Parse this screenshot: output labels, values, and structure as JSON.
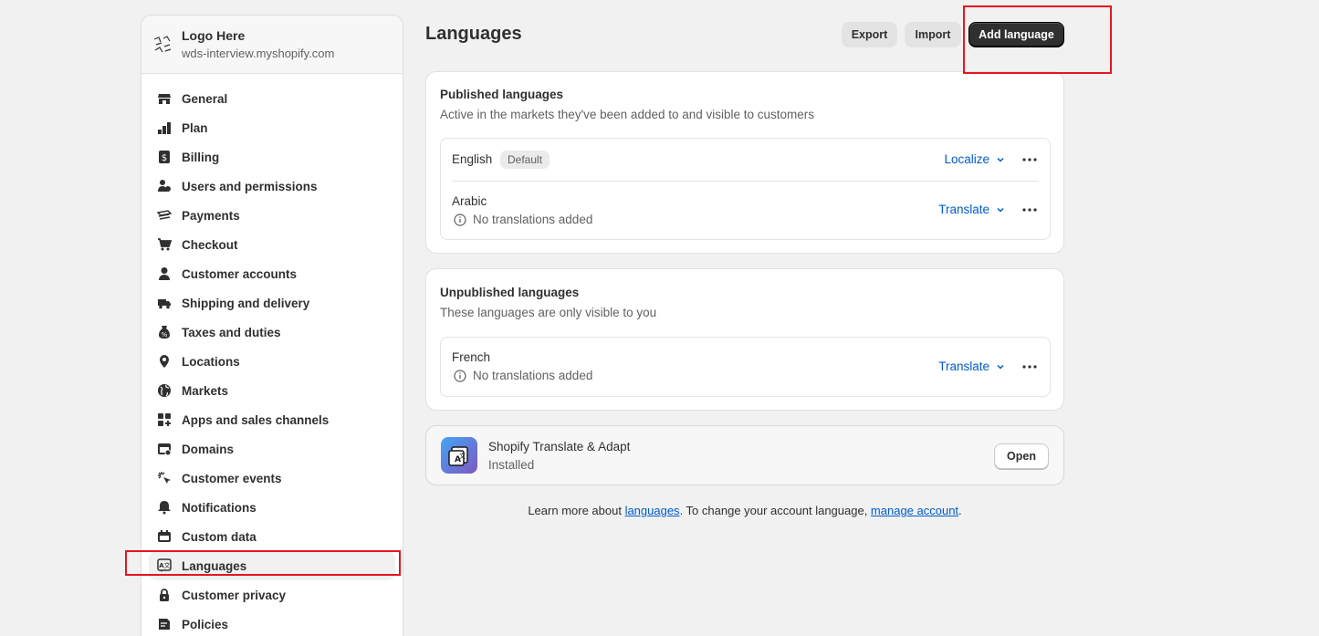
{
  "store": {
    "name": "Logo Here",
    "url": "wds-interview.myshopify.com"
  },
  "sidebar": {
    "items": [
      {
        "label": "General",
        "icon": "store-icon"
      },
      {
        "label": "Plan",
        "icon": "plan-icon"
      },
      {
        "label": "Billing",
        "icon": "billing-icon"
      },
      {
        "label": "Users and permissions",
        "icon": "users-icon"
      },
      {
        "label": "Payments",
        "icon": "payments-icon"
      },
      {
        "label": "Checkout",
        "icon": "cart-icon"
      },
      {
        "label": "Customer accounts",
        "icon": "person-icon"
      },
      {
        "label": "Shipping and delivery",
        "icon": "truck-icon"
      },
      {
        "label": "Taxes and duties",
        "icon": "tax-icon"
      },
      {
        "label": "Locations",
        "icon": "location-pin-icon"
      },
      {
        "label": "Markets",
        "icon": "globe-icon"
      },
      {
        "label": "Apps and sales channels",
        "icon": "apps-icon"
      },
      {
        "label": "Domains",
        "icon": "domains-icon"
      },
      {
        "label": "Customer events",
        "icon": "cursor-click-icon"
      },
      {
        "label": "Notifications",
        "icon": "bell-icon"
      },
      {
        "label": "Custom data",
        "icon": "custom-data-icon"
      },
      {
        "label": "Languages",
        "icon": "languages-icon"
      },
      {
        "label": "Customer privacy",
        "icon": "lock-icon"
      },
      {
        "label": "Policies",
        "icon": "policies-icon"
      }
    ],
    "active": "Languages"
  },
  "header": {
    "title": "Languages",
    "export_label": "Export",
    "import_label": "Import",
    "add_language_label": "Add language"
  },
  "published": {
    "title": "Published languages",
    "subtitle": "Active in the markets they've been added to and visible to customers",
    "languages": [
      {
        "name": "English",
        "badge": "Default",
        "action": "Localize"
      },
      {
        "name": "Arabic",
        "status": "No translations added",
        "action": "Translate"
      }
    ]
  },
  "unpublished": {
    "title": "Unpublished languages",
    "subtitle": "These languages are only visible to you",
    "languages": [
      {
        "name": "French",
        "status": "No translations added",
        "action": "Translate"
      }
    ]
  },
  "app": {
    "name": "Shopify Translate & Adapt",
    "status": "Installed",
    "open_label": "Open"
  },
  "footer": {
    "prefix": "Learn more about ",
    "link1": "languages",
    "middle": ". To change your account language, ",
    "link2": "manage account",
    "suffix": "."
  },
  "colors": {
    "accent": "#005bd3",
    "primary_button": "#303030",
    "highlight": "#e8141f"
  }
}
